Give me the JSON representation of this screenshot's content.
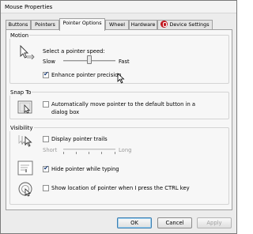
{
  "window": {
    "title": "Mouse Properties"
  },
  "tabs": [
    "Buttons",
    "Pointers",
    "Pointer Options",
    "Wheel",
    "Hardware",
    "Device Settings"
  ],
  "motion": {
    "group_label": "Motion",
    "speed_label": "Select a pointer speed:",
    "slow_label": "Slow",
    "fast_label": "Fast",
    "speed_value": 0.5,
    "precision_label": "Enhance pointer precision",
    "precision_checked": true
  },
  "snap_to": {
    "group_label": "Snap To",
    "line1": "Automatically move pointer to the default button in a",
    "line2": "dialog box",
    "checked": false
  },
  "visibility": {
    "group_label": "Visibility",
    "trails_label": "Display pointer trails",
    "trails_checked": false,
    "short_label": "Short",
    "long_label": "Long",
    "hide_label": "Hide pointer while typing",
    "hide_checked": true,
    "show_label": "Show location of pointer when I press the CTRL key",
    "show_checked": false
  },
  "buttons": {
    "ok": "OK",
    "cancel": "Cancel",
    "apply": "Apply"
  }
}
